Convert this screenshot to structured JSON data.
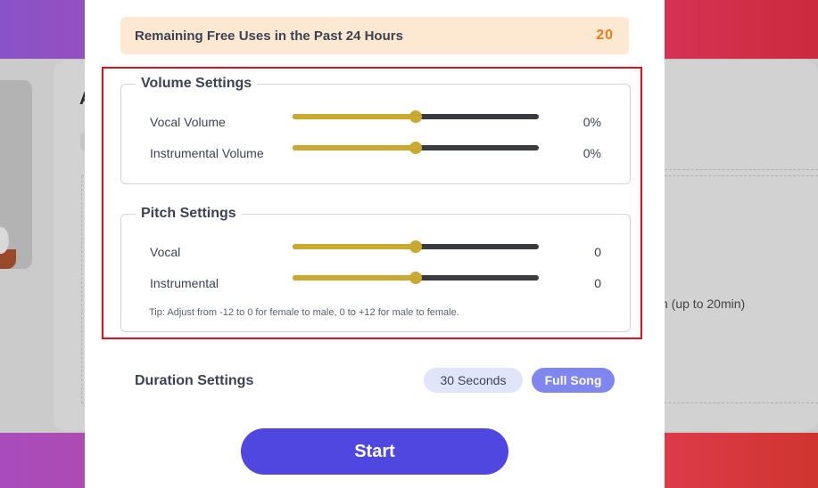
{
  "background": {
    "partial_text": "n (up to 20min)",
    "card_letter": "A"
  },
  "usage": {
    "label": "Remaining Free Uses in the Past 24 Hours",
    "count": "20"
  },
  "volume_settings": {
    "title": "Volume Settings",
    "rows": [
      {
        "label": "Vocal Volume",
        "value": "0%",
        "level": 0.5
      },
      {
        "label": "Instrumental Volume",
        "value": "0%",
        "level": 0.5
      }
    ]
  },
  "pitch_settings": {
    "title": "Pitch Settings",
    "rows": [
      {
        "label": "Vocal",
        "value": "0",
        "level": 0.5
      },
      {
        "label": "Instrumental",
        "value": "0",
        "level": 0.5
      }
    ],
    "tip": "Tip: Adjust from -12 to 0 for female to male, 0 to +12 for male to female."
  },
  "duration": {
    "label": "Duration Settings",
    "options": [
      "30 Seconds",
      "Full Song"
    ],
    "selected": "Full Song"
  },
  "start_label": "Start",
  "colors": {
    "slider_fill": "#c9aa31",
    "slider_track": "#3a3b3f",
    "accent": "#4f47e0",
    "highlight_border": "#e00f1c",
    "count_color": "#f07a16"
  }
}
